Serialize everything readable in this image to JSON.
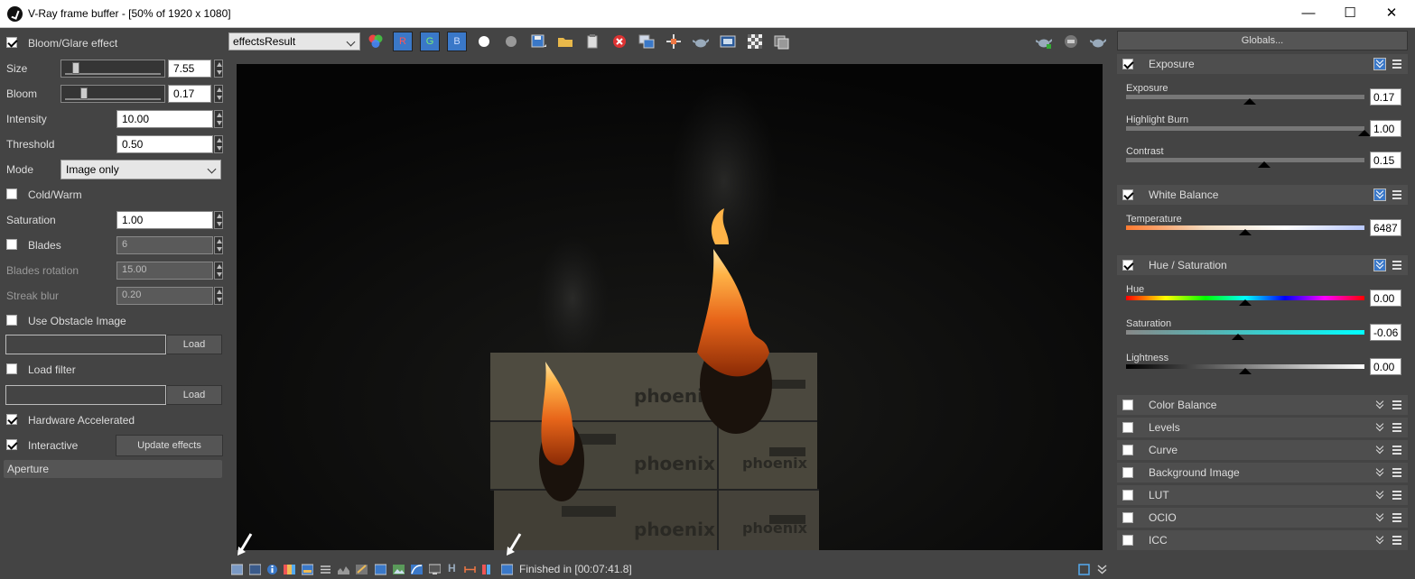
{
  "window": {
    "title": "V-Ray frame buffer - [50% of 1920 x 1080]",
    "minimize_glyph": "—",
    "maximize_glyph": "☐",
    "close_glyph": "✕"
  },
  "left_panel": {
    "bloom_glare": {
      "label": "Bloom/Glare effect",
      "checked": true
    },
    "size": {
      "label": "Size",
      "value": "7.55",
      "level": 0.08
    },
    "bloom": {
      "label": "Bloom",
      "value": "0.17",
      "level": 0.17
    },
    "intensity": {
      "label": "Intensity",
      "value": "10.00"
    },
    "threshold": {
      "label": "Threshold",
      "value": "0.50"
    },
    "mode": {
      "label": "Mode",
      "value": "Image only"
    },
    "cold_warm": {
      "label": "Cold/Warm",
      "checked": false
    },
    "saturation": {
      "label": "Saturation",
      "value": "1.00"
    },
    "blades": {
      "label": "Blades",
      "value": "6",
      "checked": false
    },
    "blades_rotation": {
      "label": "Blades rotation",
      "value": "15.00"
    },
    "streak_blur": {
      "label": "Streak blur",
      "value": "0.20"
    },
    "use_obstacle": {
      "label": "Use Obstacle Image",
      "checked": false,
      "button": "Load"
    },
    "load_filter": {
      "label": "Load filter",
      "checked": false,
      "button": "Load"
    },
    "hardware_accel": {
      "label": "Hardware Accelerated",
      "checked": true
    },
    "interactive": {
      "label": "Interactive",
      "checked": true,
      "button": "Update effects"
    },
    "aperture": {
      "label": "Aperture"
    }
  },
  "toolbar": {
    "channel": "effectsResult",
    "r": "R",
    "g": "G",
    "b": "B",
    "icons": [
      "color-channels-icon",
      "red-channel",
      "green-channel",
      "blue-channel",
      "white-circle-icon",
      "gray-circle-icon",
      "save-icon",
      "open-folder-icon",
      "clipboard-icon",
      "clear-icon",
      "duplicate-icon",
      "region-icon",
      "teapot-icon",
      "film-icon",
      "checker-icon",
      "history-icon"
    ],
    "right_icons": [
      "render-icon",
      "stop-icon",
      "teapot-render-icon"
    ]
  },
  "statusbar": {
    "status": "Finished in [00:07:41.8]",
    "h_label": "H"
  },
  "right_panel": {
    "globals": "Globals...",
    "exposure": {
      "title": "Exposure",
      "checked": true,
      "params": [
        {
          "name": "Exposure",
          "value": "0.17",
          "level": 0.52
        },
        {
          "name": "Highlight Burn",
          "value": "1.00",
          "level": 1.0
        },
        {
          "name": "Contrast",
          "value": "0.15",
          "level": 0.58
        }
      ]
    },
    "white_balance": {
      "title": "White Balance",
      "checked": true,
      "params": [
        {
          "name": "Temperature",
          "value": "6487",
          "level": 0.5
        }
      ]
    },
    "hue_saturation": {
      "title": "Hue / Saturation",
      "checked": true,
      "params": [
        {
          "name": "Hue",
          "value": "0.00",
          "level": 0.5
        },
        {
          "name": "Saturation",
          "value": "-0.06",
          "level": 0.47
        },
        {
          "name": "Lightness",
          "value": "0.00",
          "level": 0.5
        }
      ]
    },
    "collapsed": [
      "Color Balance",
      "Levels",
      "Curve",
      "Background Image",
      "LUT",
      "OCIO",
      "ICC"
    ]
  }
}
